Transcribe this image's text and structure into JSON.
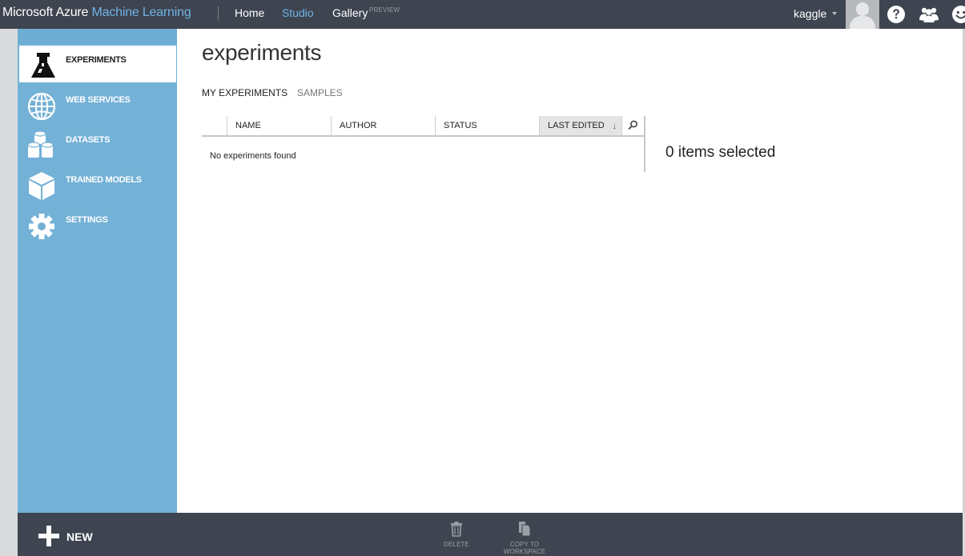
{
  "header": {
    "brand_prefix": "Microsoft Azure",
    "brand_product": "Machine Learning",
    "nav": {
      "home": "Home",
      "studio": "Studio",
      "gallery": "Gallery",
      "gallery_badge": "PREVIEW"
    },
    "user_name": "kaggle",
    "icons": [
      "user-avatar",
      "help-icon",
      "community-icon",
      "feedback-smiley-icon"
    ]
  },
  "sidebar": {
    "items": [
      {
        "label": "EXPERIMENTS",
        "icon": "flask-icon",
        "active": true
      },
      {
        "label": "WEB SERVICES",
        "icon": "globe-icon",
        "active": false
      },
      {
        "label": "DATASETS",
        "icon": "datasets-icon",
        "active": false
      },
      {
        "label": "TRAINED MODELS",
        "icon": "cube-icon",
        "active": false
      },
      {
        "label": "SETTINGS",
        "icon": "gear-icon",
        "active": false
      }
    ]
  },
  "main": {
    "title": "experiments",
    "tabs": [
      {
        "label": "MY EXPERIMENTS",
        "active": true
      },
      {
        "label": "SAMPLES",
        "active": false
      }
    ],
    "table": {
      "columns": [
        "NAME",
        "AUTHOR",
        "STATUS",
        "LAST EDITED"
      ],
      "sorted_column": "LAST EDITED",
      "sort_direction": "descending",
      "empty_message": "No experiments found"
    },
    "selection_text": "0 items selected"
  },
  "footer": {
    "new_label": "NEW",
    "commands": [
      {
        "label": "DELETE",
        "icon": "trash-icon"
      },
      {
        "label_line1": "COPY TO",
        "label_line2": "WORKSPACE",
        "icon": "copy-icon"
      }
    ]
  },
  "colors": {
    "topbar": "#3e4450",
    "sidebar": "#73b1d6",
    "accent": "#6fb4e4",
    "footer": "#3e4450"
  }
}
